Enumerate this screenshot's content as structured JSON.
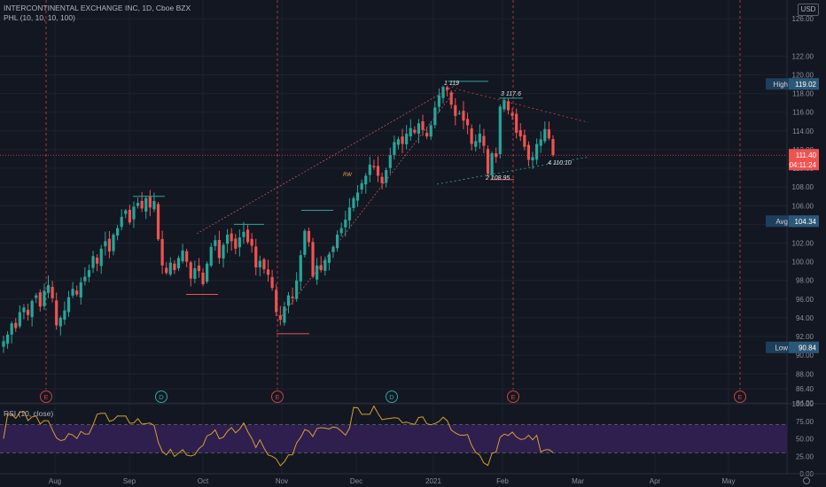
{
  "header": {
    "symbol_line": "INTERCONTINENTAL EXCHANGE INC, 1D, Cboe BZX",
    "indicator_line": "PHL (10, 10, 10, 100)",
    "currency": "USD"
  },
  "rsi_panel": {
    "label": "RSI (10, close)"
  },
  "chart_data": [
    {
      "type": "candlestick",
      "title": "INTERCONTINENTAL EXCHANGE INC, 1D, Cboe BZX",
      "ylim": [
        84.9,
        128
      ],
      "y_ticks": [
        "126.00",
        "122.00",
        "120.00",
        "118.00",
        "116.00",
        "114.00",
        "112.00",
        "110.00",
        "108.00",
        "106.00",
        "104.00",
        "102.00",
        "100.00",
        "98.00",
        "96.00",
        "94.00",
        "92.00",
        "90.00",
        "88.00",
        "86.40",
        "84.90"
      ],
      "x_labels": [
        "Aug",
        "Sep",
        "Oct",
        "Nov",
        "Dec",
        "2021",
        "Feb",
        "Mar",
        "Apr",
        "May"
      ],
      "price_markers": [
        {
          "label": "High",
          "value": "119.02"
        },
        {
          "label": "Avg",
          "value": "104.34"
        },
        {
          "label": "Low",
          "value": "90.84"
        }
      ],
      "last_price": "111.40",
      "countdown": "04:11:24",
      "annotations": [
        "1 119",
        "3 117.6",
        "2 108.95",
        "4 110.10",
        "RW"
      ],
      "event_markers": [
        "E",
        "D",
        "E",
        "D",
        "E",
        "E"
      ],
      "closes": [
        91.5,
        92.2,
        93.4,
        92.9,
        94.6,
        95.1,
        94.3,
        95.8,
        96.4,
        95.2,
        96.9,
        97.5,
        96.1,
        93.2,
        94.0,
        94.8,
        96.2,
        97.1,
        96.5,
        97.8,
        98.4,
        99.1,
        100.6,
        99.8,
        101.4,
        102.2,
        101.1,
        102.9,
        103.6,
        104.8,
        105.5,
        104.2,
        105.9,
        106.3,
        105.7,
        106.8,
        105.8,
        106.5,
        102.4,
        99.6,
        98.8,
        99.9,
        99.1,
        100.4,
        101.2,
        100.0,
        98.2,
        99.3,
        99.0,
        97.6,
        99.8,
        101.6,
        102.3,
        100.4,
        101.8,
        102.9,
        102.2,
        101.4,
        102.6,
        103.2,
        102.1,
        101.7,
        99.4,
        100.1,
        99.2,
        98.6,
        97.2,
        94.6,
        93.8,
        95.2,
        96.4,
        96.1,
        98.0,
        100.7,
        103.3,
        102.1,
        98.4,
        99.6,
        99.1,
        100.2,
        100.8,
        101.6,
        102.9,
        103.6,
        104.5,
        105.8,
        106.8,
        107.4,
        108.4,
        109.2,
        110.4,
        110.1,
        109.2,
        108.4,
        109.8,
        111.4,
        112.8,
        113.1,
        112.6,
        113.7,
        114.3,
        113.8,
        114.8,
        114.1,
        113.4,
        114.6,
        116.5,
        117.8,
        118.7,
        118.4,
        116.8,
        115.6,
        115.9,
        115.1,
        114.6,
        112.6,
        112.9,
        113.7,
        112.4,
        109.4,
        111.6,
        111.2,
        116.6,
        117.3,
        116.2,
        115.6,
        113.8,
        113.4,
        112.3,
        110.9,
        111.2,
        112.6,
        113.1,
        114.2,
        113.2,
        111.4
      ]
    },
    {
      "type": "line",
      "title": "RSI (10, close)",
      "ylim": [
        0,
        100
      ],
      "y_ticks": [
        "100.00",
        "75.00",
        "50.00",
        "25.00",
        "0.00"
      ],
      "levels": [
        70,
        30
      ],
      "x_labels": [
        "Aug",
        "Sep",
        "Oct",
        "Nov",
        "Dec",
        "2021",
        "Feb",
        "Mar",
        "Apr",
        "May"
      ]
    }
  ],
  "colors": {
    "up": "#26a69a",
    "down": "#ef5350",
    "background": "#131722",
    "rsi_line": "#d4a02c",
    "rsi_band": "#2e1f4f"
  }
}
